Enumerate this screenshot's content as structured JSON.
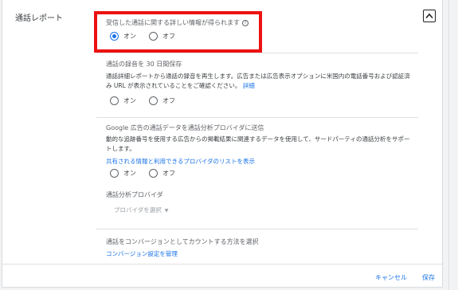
{
  "section": {
    "title": "通話レポート"
  },
  "detailed_info": {
    "label": "受信した通話に関する詳しい情報が得られます",
    "on": "オン",
    "off": "オフ",
    "selected": "on"
  },
  "recording": {
    "label": "通話の録音を 30 日間保存",
    "desc_line1": "通話詳細レポートから通話の録音を再生します。広告または広告表示オプションに米国内の電話番号および認証済",
    "desc_line2": "み URL が表示されていることをご確認ください。",
    "link": "詳細",
    "on": "オン",
    "off": "オフ"
  },
  "share": {
    "label": "Google 広告の通話データを通話分析プロバイダに送信",
    "desc_line1": "動的な追跡番号を使用する広告からの掲載結果に関連するデータを使用して、サードパーティの通話分析をサポー",
    "desc_line2": "トします。",
    "link": "共有される情報と利用できるプロバイダのリストを表示",
    "on": "オン",
    "off": "オフ"
  },
  "provider": {
    "label": "通話分析プロバイダ",
    "placeholder": "プロバイダを選択",
    "caret": "▼"
  },
  "conversion": {
    "label": "通話をコンバージョンとしてカウントする方法を選択",
    "link": "コンバージョン設定を管理"
  },
  "footer": {
    "cancel": "キャンセル",
    "save": "保存"
  }
}
